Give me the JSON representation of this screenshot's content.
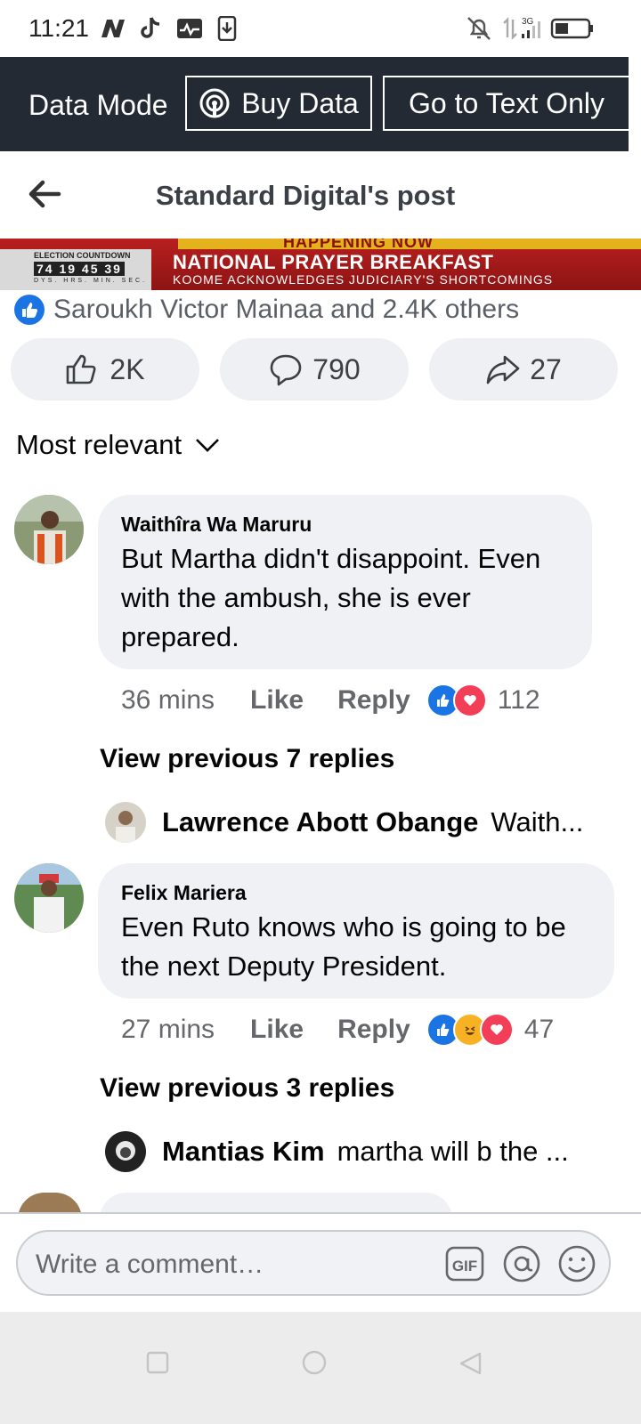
{
  "status_bar": {
    "time": "11:21",
    "network": "3G"
  },
  "data_bar": {
    "mode_label": "Data Mode",
    "buy_label": "Buy Data",
    "text_only_label": "Go to Text Only"
  },
  "header": {
    "title": "Standard Digital's post"
  },
  "banner": {
    "happening": "HAPPENING NOW",
    "countdown_label": "ELECTION COUNTDOWN",
    "countdown_values": "74 19 45 39",
    "countdown_units": "DYS. HRS. MIN. SEC.",
    "headline": "NATIONAL PRAYER BREAKFAST",
    "subheadline": "KOOME ACKNOWLEDGES JUDICIARY'S SHORTCOMINGS"
  },
  "likes_summary": "Saroukh Victor Mainaa and 2.4K others",
  "actions": {
    "likes": "2K",
    "comments": "790",
    "shares": "27"
  },
  "sort_label": "Most relevant",
  "comments": [
    {
      "author": "Waithîra Wa Maruru",
      "lines": [
        "But Martha didn't disappoint. Even",
        "with the ambush, she is ever",
        "prepared."
      ],
      "time": "36 mins",
      "like": "Like",
      "reply": "Reply",
      "reaction_count": "112",
      "view_previous": "View previous 7 replies",
      "reply_preview": {
        "name": "Lawrence Abott Obange",
        "text": "Waith..."
      }
    },
    {
      "author": "Felix Mariera",
      "lines": [
        "Even Ruto knows who is going to be",
        "the next Deputy President."
      ],
      "time": "27 mins",
      "like": "Like",
      "reply": "Reply",
      "reaction_count": "47",
      "view_previous": "View previous 3 replies",
      "reply_preview": {
        "name": "Mantias Kim",
        "text": "martha will b the ..."
      }
    }
  ],
  "composer": {
    "placeholder": "Write a comment…",
    "gif_label": "GIF"
  },
  "colors": {
    "facebook_blue": "#1b74e4",
    "love_red": "#f33e58",
    "dark_bar": "#242a33"
  }
}
